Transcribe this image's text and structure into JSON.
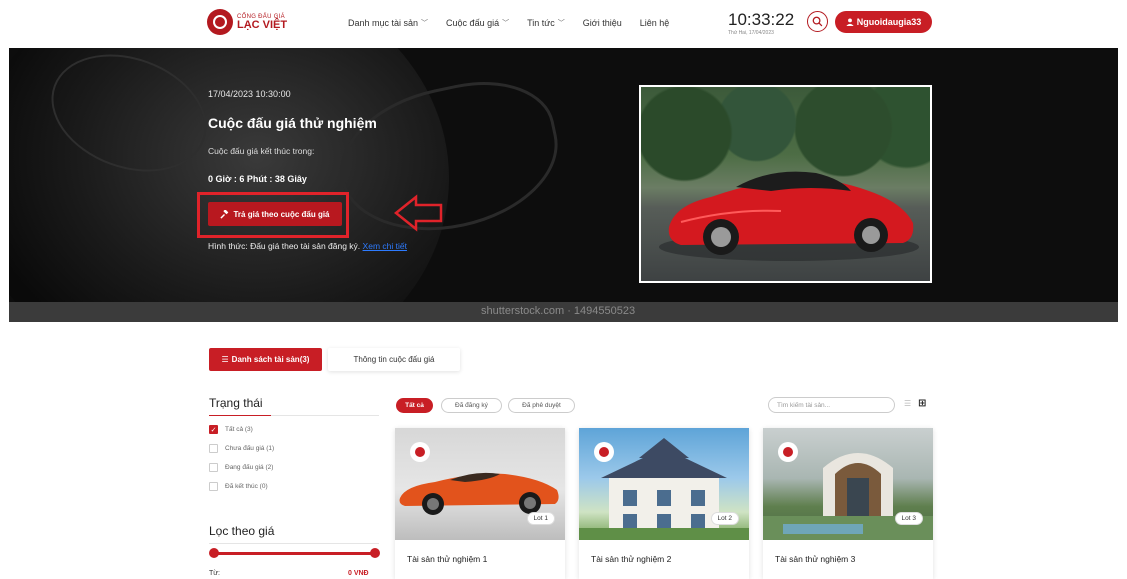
{
  "header": {
    "logo_top": "CỔNG ĐẤU GIÁ",
    "logo_bottom": "LẠC VIỆT",
    "nav": [
      {
        "label": "Danh mục tài sản",
        "has_dropdown": true
      },
      {
        "label": "Cuộc đấu giá",
        "has_dropdown": true
      },
      {
        "label": "Tin tức",
        "has_dropdown": true
      },
      {
        "label": "Giới thiệu",
        "has_dropdown": false
      },
      {
        "label": "Liên hệ",
        "has_dropdown": false
      }
    ],
    "clock_time": "10:33:22",
    "clock_date": "Thứ Hai, 17/04/2023",
    "user_label": "Nguoidaugia33",
    "accent_color": "#c81e25"
  },
  "hero": {
    "date": "17/04/2023 10:30:00",
    "title": "Cuộc đấu giá thử nghiệm",
    "subtitle": "Cuộc đấu giá kết thúc trong:",
    "countdown": "0 Giờ : 6 Phút : 38 Giây",
    "bid_button": "Trả giá theo cuộc đấu giá",
    "form_label": "Hình thức: Đấu giá theo tài sản đăng ký.",
    "form_link": "Xem chi tiết",
    "watermark": "shutterstock.com · 1494550523"
  },
  "tabs": {
    "assets": "Danh sách tài sản(3)",
    "info": "Thông tin cuộc đấu giá"
  },
  "sidebar": {
    "status_title": "Trạng thái",
    "statuses": [
      {
        "label": "Tất cả (3)",
        "checked": true
      },
      {
        "label": "Chưa đấu giá (1)",
        "checked": false
      },
      {
        "label": "Đang đấu giá (2)",
        "checked": false
      },
      {
        "label": "Đã kết thúc (0)",
        "checked": false
      }
    ],
    "price_title": "Lọc theo giá",
    "from_label": "Từ:",
    "from_value": "0 VNĐ"
  },
  "filters": {
    "pills": [
      "Tất cả",
      "Đã đăng ký",
      "Đã phê duyệt"
    ],
    "active_index": 0,
    "search_placeholder": "Tìm kiếm tài sản..."
  },
  "cards": [
    {
      "name": "Tài sản thử nghiệm 1",
      "lot": "Lot 1"
    },
    {
      "name": "Tài sản thử nghiệm 2",
      "lot": "Lot 2"
    },
    {
      "name": "Tài sản thử nghiệm 3",
      "lot": "Lot 3"
    }
  ]
}
